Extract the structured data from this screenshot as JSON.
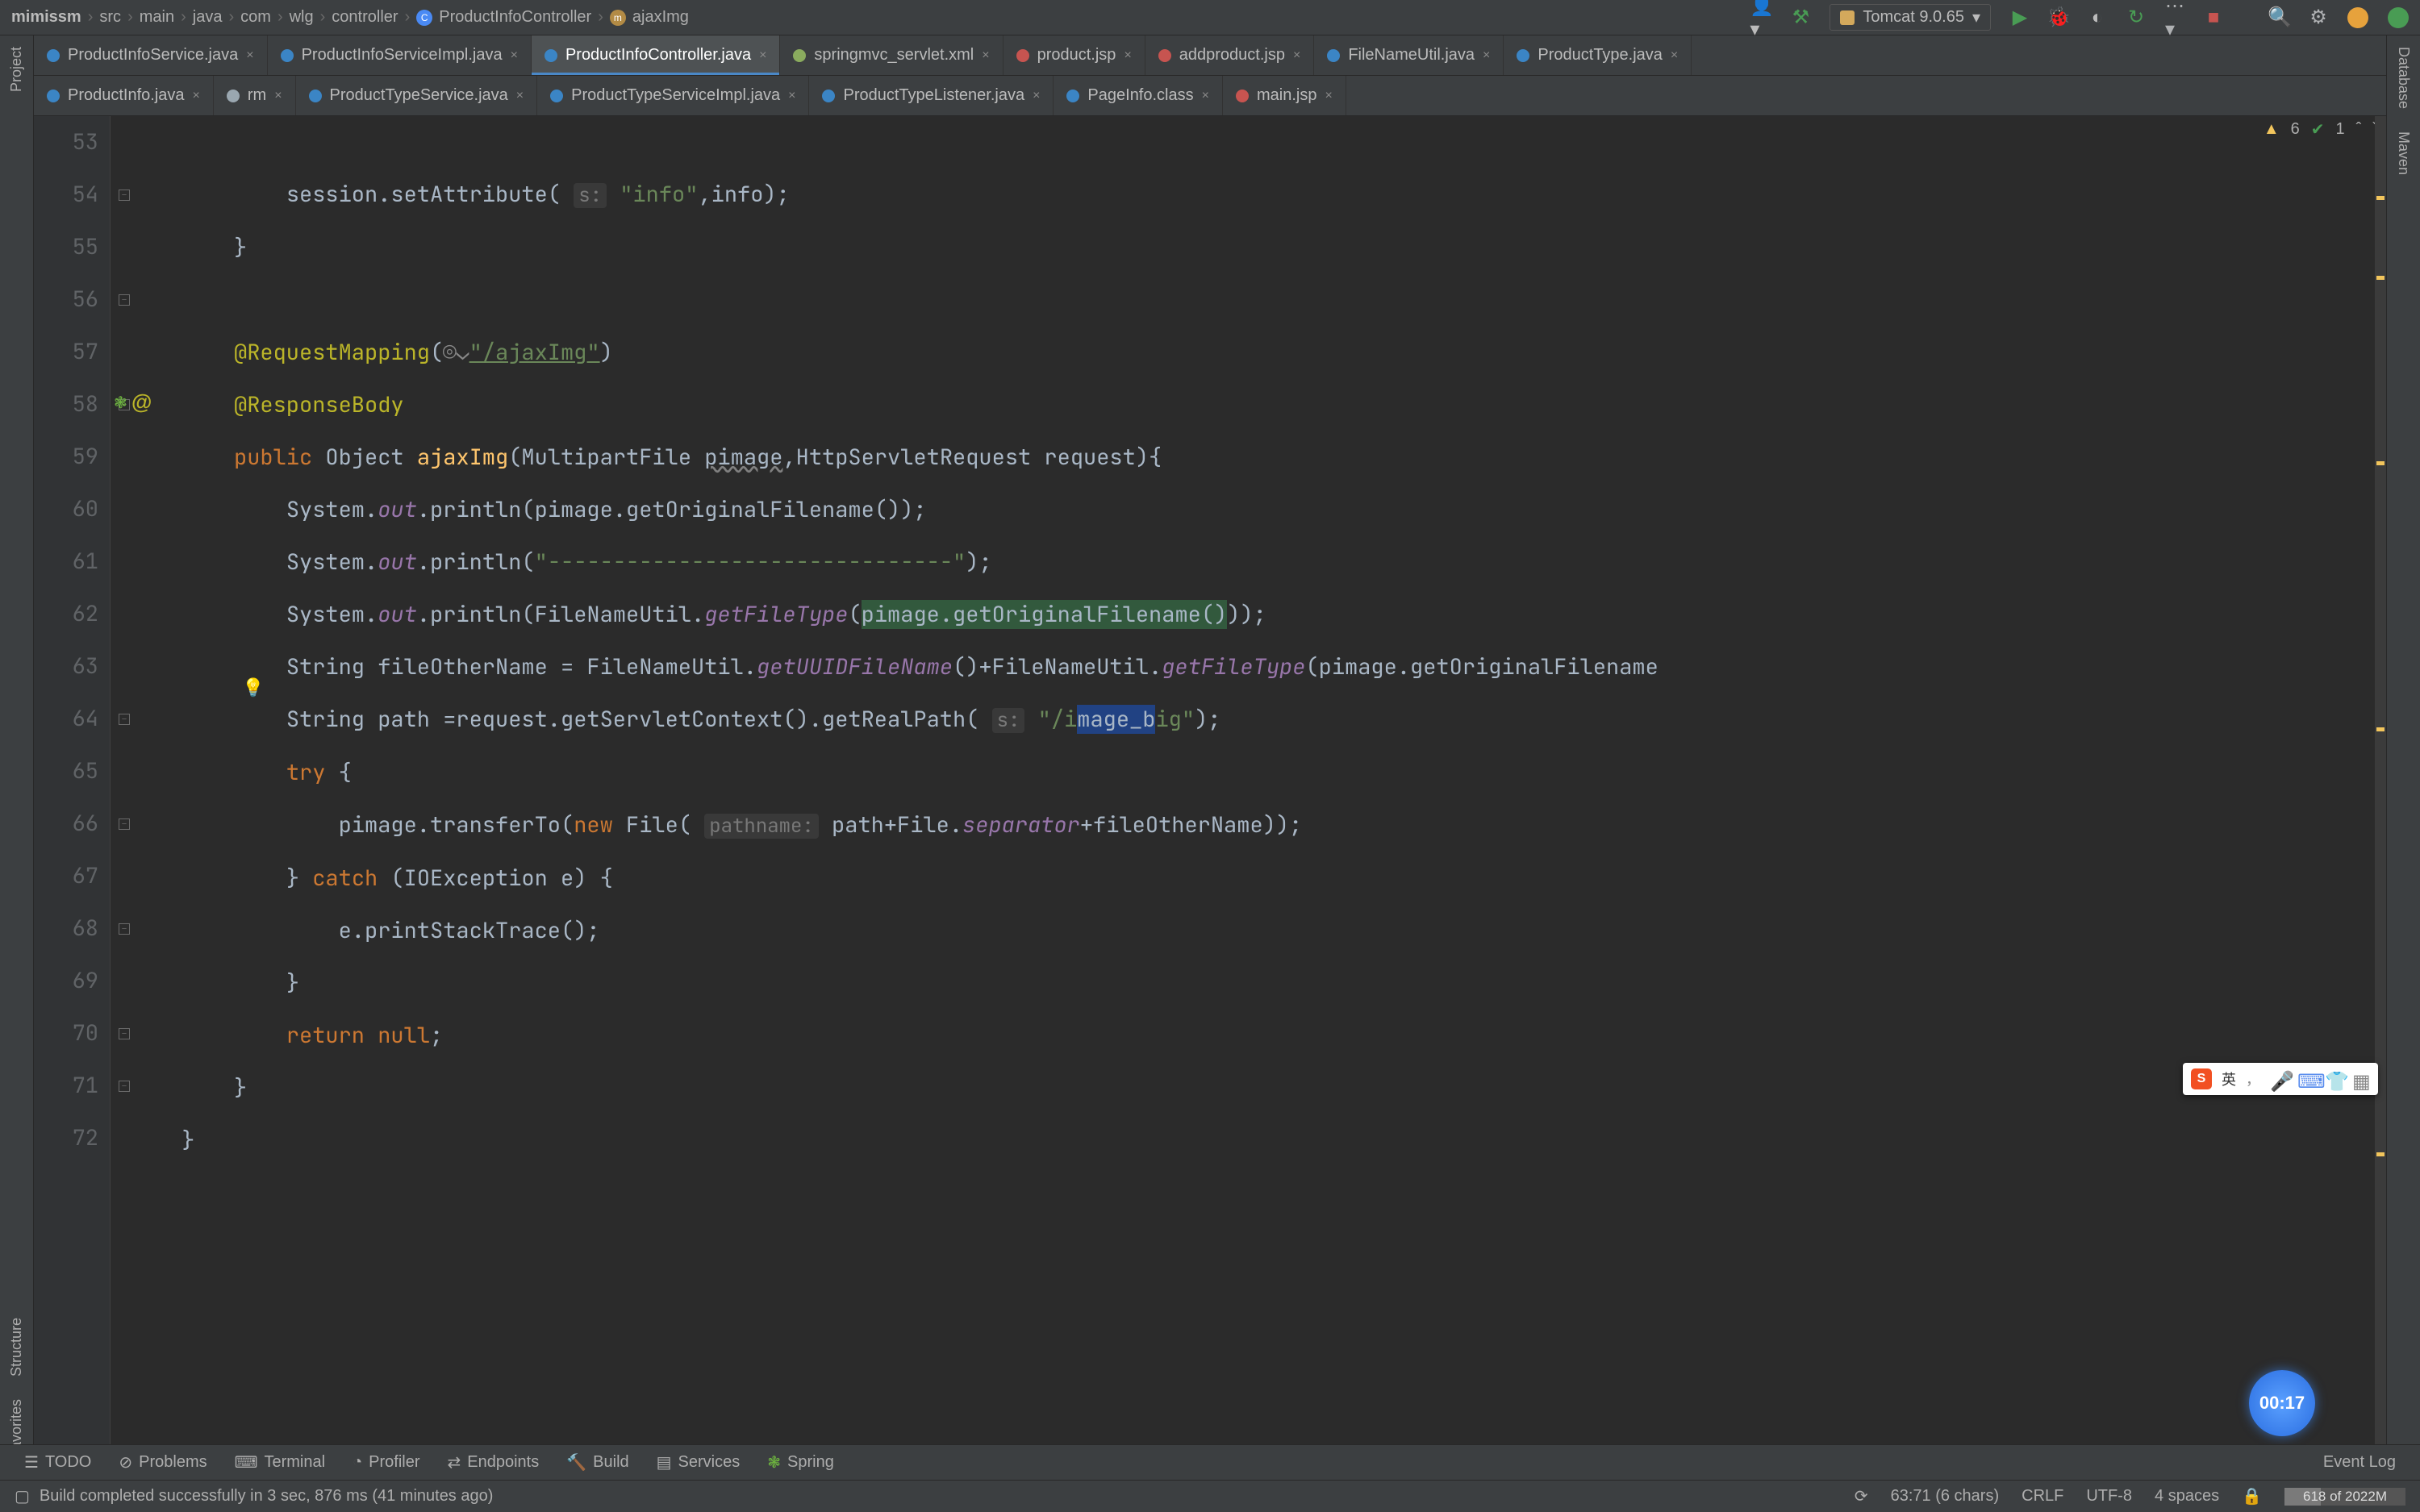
{
  "breadcrumbs": [
    "mimissm",
    "src",
    "main",
    "java",
    "com",
    "wlg",
    "controller",
    "ProductInfoController",
    "ajaxImg"
  ],
  "run_config": "Tomcat 9.0.65",
  "tabs_row1": [
    {
      "label": "ProductInfoService.java",
      "icon": "java"
    },
    {
      "label": "ProductInfoServiceImpl.java",
      "icon": "java"
    },
    {
      "label": "ProductInfoController.java",
      "icon": "java",
      "active": true
    },
    {
      "label": "springmvc_servlet.xml",
      "icon": "xml"
    },
    {
      "label": "product.jsp",
      "icon": "jsp"
    },
    {
      "label": "addproduct.jsp",
      "icon": "jsp"
    },
    {
      "label": "FileNameUtil.java",
      "icon": "java"
    },
    {
      "label": "ProductType.java",
      "icon": "java"
    }
  ],
  "tabs_row2": [
    {
      "label": "ProductInfo.java",
      "icon": "java"
    },
    {
      "label": "rm",
      "icon": "txt"
    },
    {
      "label": "ProductTypeService.java",
      "icon": "java"
    },
    {
      "label": "ProductTypeServiceImpl.java",
      "icon": "java"
    },
    {
      "label": "ProductTypeListener.java",
      "icon": "java"
    },
    {
      "label": "PageInfo.class",
      "icon": "cls"
    },
    {
      "label": "main.jsp",
      "icon": "jsp"
    }
  ],
  "left_rail": [
    "Project",
    "Structure",
    "Favorites"
  ],
  "right_rail": [
    "Database",
    "Maven"
  ],
  "lines": {
    "start": 53,
    "end": 72
  },
  "inspection": {
    "warn_count": "6",
    "typo_count": "1"
  },
  "bottom_tools": [
    "TODO",
    "Problems",
    "Terminal",
    "Profiler",
    "Endpoints",
    "Build",
    "Services",
    "Spring"
  ],
  "status_msg": "Build completed successfully in 3 sec, 876 ms (41 minutes ago)",
  "status_right": {
    "pos": "63:71 (6 chars)",
    "lf": "CRLF",
    "enc": "UTF-8",
    "indent": "4 spaces",
    "mem": "618 of 2022M",
    "event": "Event Log"
  },
  "rec_time": "00:17",
  "ime_lang": "英",
  "code": {
    "l53": "session.setAttribute(",
    "l53_hint": "s:",
    "l53_str": "\"info\"",
    "l53_tail": ",info);",
    "l54": "}",
    "l56_ann": "@RequestMapping",
    "l56_arg": "\"/ajaxImg\"",
    "l57_ann": "@ResponseBody",
    "l58_sig_pub": "public",
    "l58_sig_obj": " Object ",
    "l58_met": "ajaxImg",
    "l58_args_a": "(MultipartFile ",
    "l58_args_p": "pimage",
    "l58_args_b": ",HttpServletRequest request){",
    "l59_a": "System.",
    "l59_out": "out",
    "l59_b": ".println(pimage.getOriginalFilename());",
    "l60_a": "System.",
    "l60_b": ".println(",
    "l60_str": "\"-------------------------------\"",
    "l60_c": ");",
    "l61_a": "System.",
    "l61_b": ".println(FileNameUtil.",
    "l61_m": "getFileType",
    "l61_c": "(",
    "l61_high": "pimage.getOriginalFilename()",
    "l61_d": "));",
    "l62_a": "String fileOtherName = FileNameUtil.",
    "l62_m1": "getUUIDFileName",
    "l62_b": "()+FileNameUtil.",
    "l62_m2": "getFileType",
    "l62_c": "(pimage.getOriginalFilename",
    "l63_a": "String path =request.getServletContext().getRealPath(",
    "l63_hint": "s:",
    "l63_str_a": "\"/i",
    "l63_sel": "mage_b",
    "l63_str_b": "ig\"",
    "l63_c": ");",
    "l64_try": "try",
    "l64_b": " {",
    "l65_a": "pimage.transferTo(",
    "l65_new": "new",
    "l65_b": " File(",
    "l65_hint": "pathname:",
    "l65_c": " path+File.",
    "l65_sep": "separator",
    "l65_d": "+fileOtherName));",
    "l66_a": "} ",
    "l66_catch": "catch",
    "l66_b": " (IOException e) {",
    "l67": "e.printStackTrace();",
    "l68": "}",
    "l69_ret": "return",
    "l69_null": " null",
    "l69_c": ";",
    "l70": "}",
    "l71": "}"
  }
}
